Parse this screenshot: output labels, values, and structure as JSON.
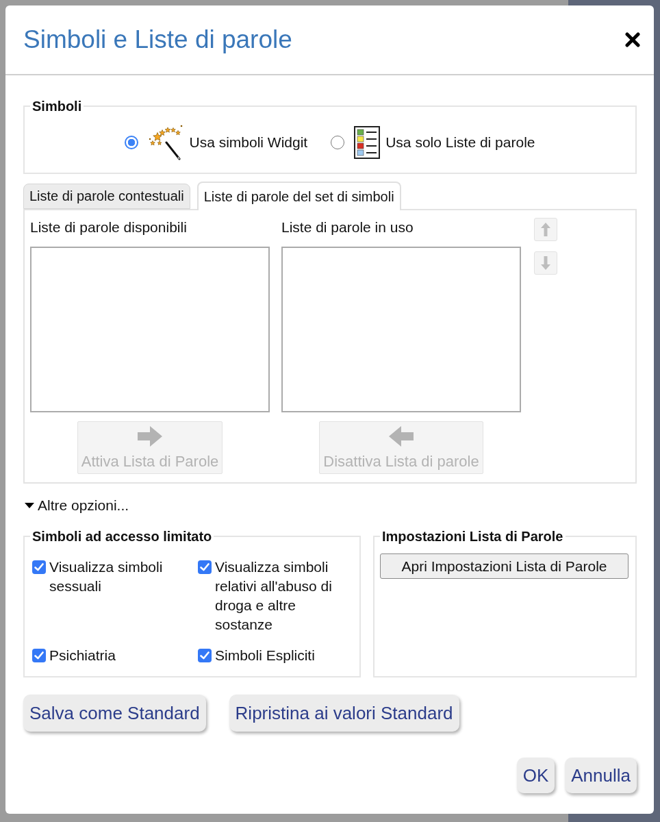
{
  "dialog": {
    "title": "Simboli e Liste di parole"
  },
  "symbols": {
    "legend": "Simboli",
    "options": [
      {
        "kind": "wand",
        "label": "Usa simboli Widgit",
        "selected": true
      },
      {
        "kind": "list",
        "label": "Usa solo Liste di parole",
        "selected": false
      }
    ]
  },
  "tabs": [
    {
      "label": "Liste di parole contestuali",
      "selected": false
    },
    {
      "label": "Liste di parole del set di simboli",
      "selected": true
    }
  ],
  "tab_panel": {
    "lists": [
      {
        "label": "Liste di parole disponibili",
        "button": {
          "kind": "right",
          "label": "Attiva Lista di Parole",
          "disabled": true
        }
      },
      {
        "label": "Liste di parole in uso",
        "button": {
          "kind": "left",
          "label": "Disattiva Lista di parole",
          "disabled": true
        }
      }
    ],
    "move_buttons": [
      {
        "kind": "up",
        "disabled": true
      },
      {
        "kind": "down",
        "disabled": true
      }
    ]
  },
  "more_options": {
    "label": "Altre opzioni...",
    "expanded": true
  },
  "restricted": {
    "legend": "Simboli ad accesso limitato",
    "checkboxes": [
      {
        "label": "Visualizza simboli sessuali",
        "checked": true
      },
      {
        "label": "Visualizza simboli relativi all'abuso di droga e altre sostanze",
        "checked": true
      },
      {
        "label": "Psichiatria",
        "checked": true
      },
      {
        "label": "Simboli Espliciti",
        "checked": true
      }
    ]
  },
  "word_list_settings": {
    "legend": "Impostazioni Lista di Parole",
    "button": "Apri Impostazioni Lista di Parole"
  },
  "default_buttons": [
    "Salva come Standard",
    "Ripristina ai valori Standard"
  ],
  "dialog_buttons": [
    "OK",
    "Annulla"
  ]
}
